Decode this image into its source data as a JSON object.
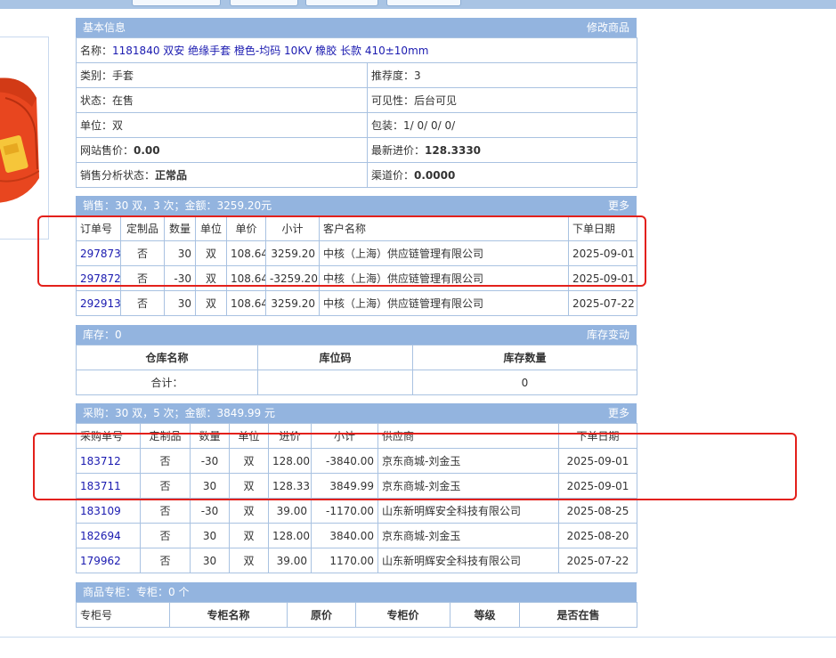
{
  "basic": {
    "title": "基本信息",
    "edit_link": "修改商品",
    "name_label": "名称：",
    "name_value": "1181840 双安 绝缘手套 橙色-均码 10KV 橡胶 长款 410±10mm",
    "category_label": "类别：",
    "category_value": "手套",
    "recommend_label": "推荐度：",
    "recommend_value": "3",
    "status_label": "状态：",
    "status_value": "在售",
    "visibility_label": "可见性：",
    "visibility_value": "后台可见",
    "unit_label": "单位：",
    "unit_value": "双",
    "package_label": "包装：",
    "package_value": "1/ 0/ 0/ 0/",
    "site_price_label": "网站售价：",
    "site_price_value": "0.00",
    "latest_cost_label": "最新进价：",
    "latest_cost_value": "128.3330",
    "sales_status_label": "销售分析状态：",
    "sales_status_value": "正常品",
    "channel_price_label": "渠道价：",
    "channel_price_value": "0.0000"
  },
  "sales": {
    "title": "销售：30 双，3 次；金额：3259.20元",
    "more": "更多",
    "headers": [
      "订单号",
      "定制品",
      "数量",
      "单位",
      "单价",
      "小计",
      "客户名称",
      "下单日期"
    ],
    "rows": [
      [
        "297873",
        "否",
        "30",
        "双",
        "108.64",
        "3259.20",
        "中核（上海）供应链管理有限公司",
        "2025-09-01"
      ],
      [
        "297872",
        "否",
        "-30",
        "双",
        "108.64",
        "-3259.20",
        "中核（上海）供应链管理有限公司",
        "2025-09-01"
      ],
      [
        "292913",
        "否",
        "30",
        "双",
        "108.64",
        "3259.20",
        "中核（上海）供应链管理有限公司",
        "2025-07-22"
      ]
    ]
  },
  "stock": {
    "title": "库存：0",
    "change_link": "库存变动",
    "headers": [
      "仓库名称",
      "库位码",
      "库存数量"
    ],
    "total_label": "合计：",
    "total_value": "0"
  },
  "purchase": {
    "title": "采购：30 双，5 次；金额：3849.99 元",
    "more": "更多",
    "headers": [
      "采购单号",
      "定制品",
      "数量",
      "单位",
      "进价",
      "小计",
      "供应商",
      "下单日期"
    ],
    "rows": [
      [
        "183712",
        "否",
        "-30",
        "双",
        "128.00",
        "-3840.00",
        "京东商城-刘金玉",
        "2025-09-01"
      ],
      [
        "183711",
        "否",
        "30",
        "双",
        "128.33",
        "3849.99",
        "京东商城-刘金玉",
        "2025-09-01"
      ],
      [
        "183109",
        "否",
        "-30",
        "双",
        "39.00",
        "-1170.00",
        "山东新明辉安全科技有限公司",
        "2025-08-25"
      ],
      [
        "182694",
        "否",
        "30",
        "双",
        "128.00",
        "3840.00",
        "京东商城-刘金玉",
        "2025-08-20"
      ],
      [
        "179962",
        "否",
        "30",
        "双",
        "39.00",
        "1170.00",
        "山东新明辉安全科技有限公司",
        "2025-07-22"
      ]
    ]
  },
  "counter": {
    "title": "商品专柜：专柜：0 个",
    "headers": [
      "专柜号",
      "专柜名称",
      "原价",
      "专柜价",
      "等级",
      "是否在售"
    ]
  },
  "colors": {
    "header_bar": "#93b4df",
    "border": "#a9c2e1",
    "link": "#1a1ab0",
    "highlight": "#e3201b"
  }
}
